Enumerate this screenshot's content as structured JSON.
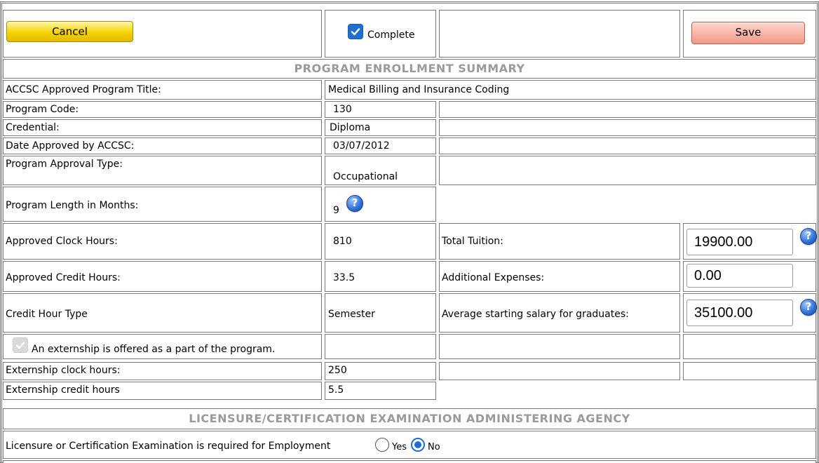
{
  "toolbar": {
    "cancel_label": "Cancel",
    "save_label": "Save",
    "complete_label": "Complete",
    "complete_checked": true
  },
  "section1": {
    "title": "PROGRAM ENROLLMENT SUMMARY"
  },
  "fields": {
    "program_title": {
      "label": "ACCSC Approved Program Title:",
      "value": "Medical Billing and Insurance Coding"
    },
    "program_code": {
      "label": "Program Code:",
      "value": "130"
    },
    "credential": {
      "label": "Credential:",
      "value": "Diploma"
    },
    "date_approved": {
      "label": "Date Approved by ACCSC:",
      "value": "03/07/2012"
    },
    "approval_type": {
      "label": "Program Approval Type:",
      "value": "Occupational"
    },
    "length_months": {
      "label": "Program Length in Months:",
      "value": "9"
    },
    "clock_hours": {
      "label": "Approved Clock Hours:",
      "value": "810"
    },
    "credit_hours": {
      "label": "Approved Credit Hours:",
      "value": "33.5"
    },
    "credit_type": {
      "label": "Credit Hour Type",
      "value": "Semester"
    },
    "total_tuition": {
      "label": "Total Tuition:",
      "value": "19900.00"
    },
    "additional_expenses": {
      "label": "Additional Expenses:",
      "value": "0.00"
    },
    "avg_salary": {
      "label": "Average starting salary for graduates:",
      "value": "35100.00"
    },
    "externship_offered": {
      "label": "An externship is offered as a part of the program.",
      "checked": true
    },
    "externship_clock": {
      "label": "Externship clock hours:",
      "value": "250"
    },
    "externship_credit": {
      "label": "Externship credit hours",
      "value": "5.5"
    }
  },
  "section2": {
    "title": "LICENSURE/CERTIFICATION EXAMINATION ADMINISTERING AGENCY"
  },
  "licensure": {
    "question": "Licensure or Certification Examination is required for Employment",
    "options": [
      "Yes",
      "No"
    ],
    "selected": "No"
  },
  "icons": {
    "help": "help-question-icon",
    "check": "checkmark-icon"
  }
}
